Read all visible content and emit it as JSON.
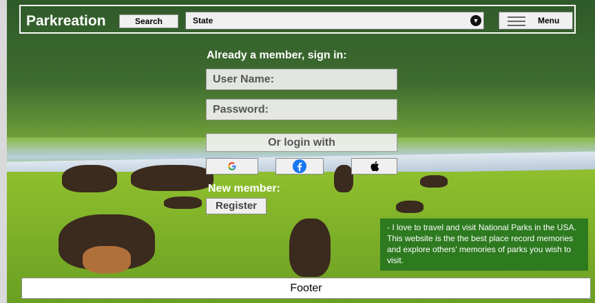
{
  "header": {
    "brand": "Parkreation",
    "search_label": "Search",
    "state_value": "State",
    "menu_label": "Menu"
  },
  "login": {
    "title": "Already a member, sign in:",
    "username_placeholder": "User Name:",
    "password_placeholder": "Password:",
    "alt_login_label": "Or login with",
    "providers": [
      "google",
      "facebook",
      "apple"
    ]
  },
  "register": {
    "title": "New member:",
    "button_label": "Register"
  },
  "testimonial": {
    "text": "- I love to travel and visit National Parks in the USA. This website is the the best place record memories and explore others' memories of parks you wish to visit."
  },
  "footer": {
    "label": "Footer"
  },
  "colors": {
    "testimonial_bg": "#2d7a1f",
    "google_blue": "#4285F4",
    "facebook_blue": "#1877F2"
  }
}
